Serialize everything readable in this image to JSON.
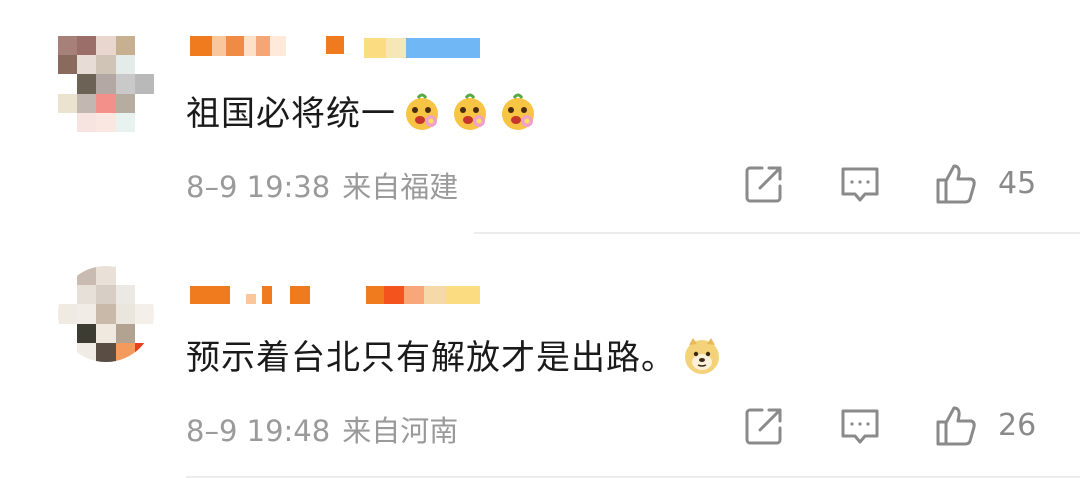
{
  "comments": [
    {
      "text": "祖国必将统一",
      "emojis": [
        "flower-face-emoji",
        "flower-face-emoji",
        "flower-face-emoji"
      ],
      "time": "8–9 19:38",
      "location": "来自福建",
      "likes": "45"
    },
    {
      "text": "预示着台北只有解放才是出路。",
      "emojis": [
        "doge-emoji"
      ],
      "time": "8–9 19:48",
      "location": "来自河南",
      "likes": "26"
    }
  ],
  "icons": {
    "share": "share-icon",
    "reply": "comment-icon",
    "like": "thumbs-up-icon"
  },
  "colors": {
    "text": "#1a1a1a",
    "meta": "#9a9a9a",
    "icon": "#8a8a8a",
    "divider": "#ececec"
  }
}
